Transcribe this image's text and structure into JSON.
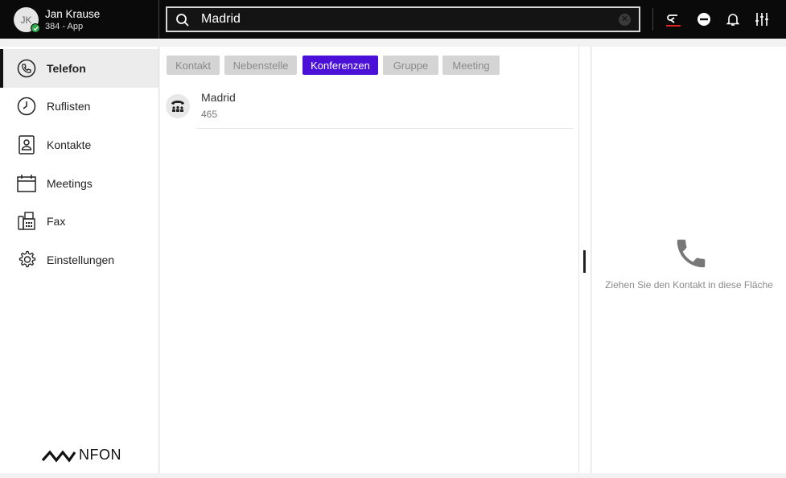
{
  "user": {
    "initials": "JK",
    "name": "Jan Krause",
    "extension": "384 - App"
  },
  "search": {
    "value": "Madrid",
    "placeholder": ""
  },
  "sidebar": {
    "items": [
      {
        "label": "Telefon",
        "icon": "phone-icon",
        "active": true
      },
      {
        "label": "Ruflisten",
        "icon": "clock-icon"
      },
      {
        "label": "Kontakte",
        "icon": "contact-card-icon"
      },
      {
        "label": "Meetings",
        "icon": "calendar-icon"
      },
      {
        "label": "Fax",
        "icon": "fax-icon"
      },
      {
        "label": "Einstellungen",
        "icon": "gear-icon"
      }
    ],
    "logo": "NFON"
  },
  "tabs": [
    {
      "label": "Kontakt"
    },
    {
      "label": "Nebenstelle"
    },
    {
      "label": "Konferenzen",
      "active": true
    },
    {
      "label": "Gruppe"
    },
    {
      "label": "Meeting"
    }
  ],
  "results": [
    {
      "name": "Madrid",
      "number": "465",
      "icon": "conference-phone-icon"
    }
  ],
  "drop_zone": {
    "text": "Ziehen Sie den Kontakt in diese Fläche"
  },
  "colors": {
    "accent": "#4a10d8",
    "status": "#2ea84a",
    "forward_underline": "#e02020"
  }
}
